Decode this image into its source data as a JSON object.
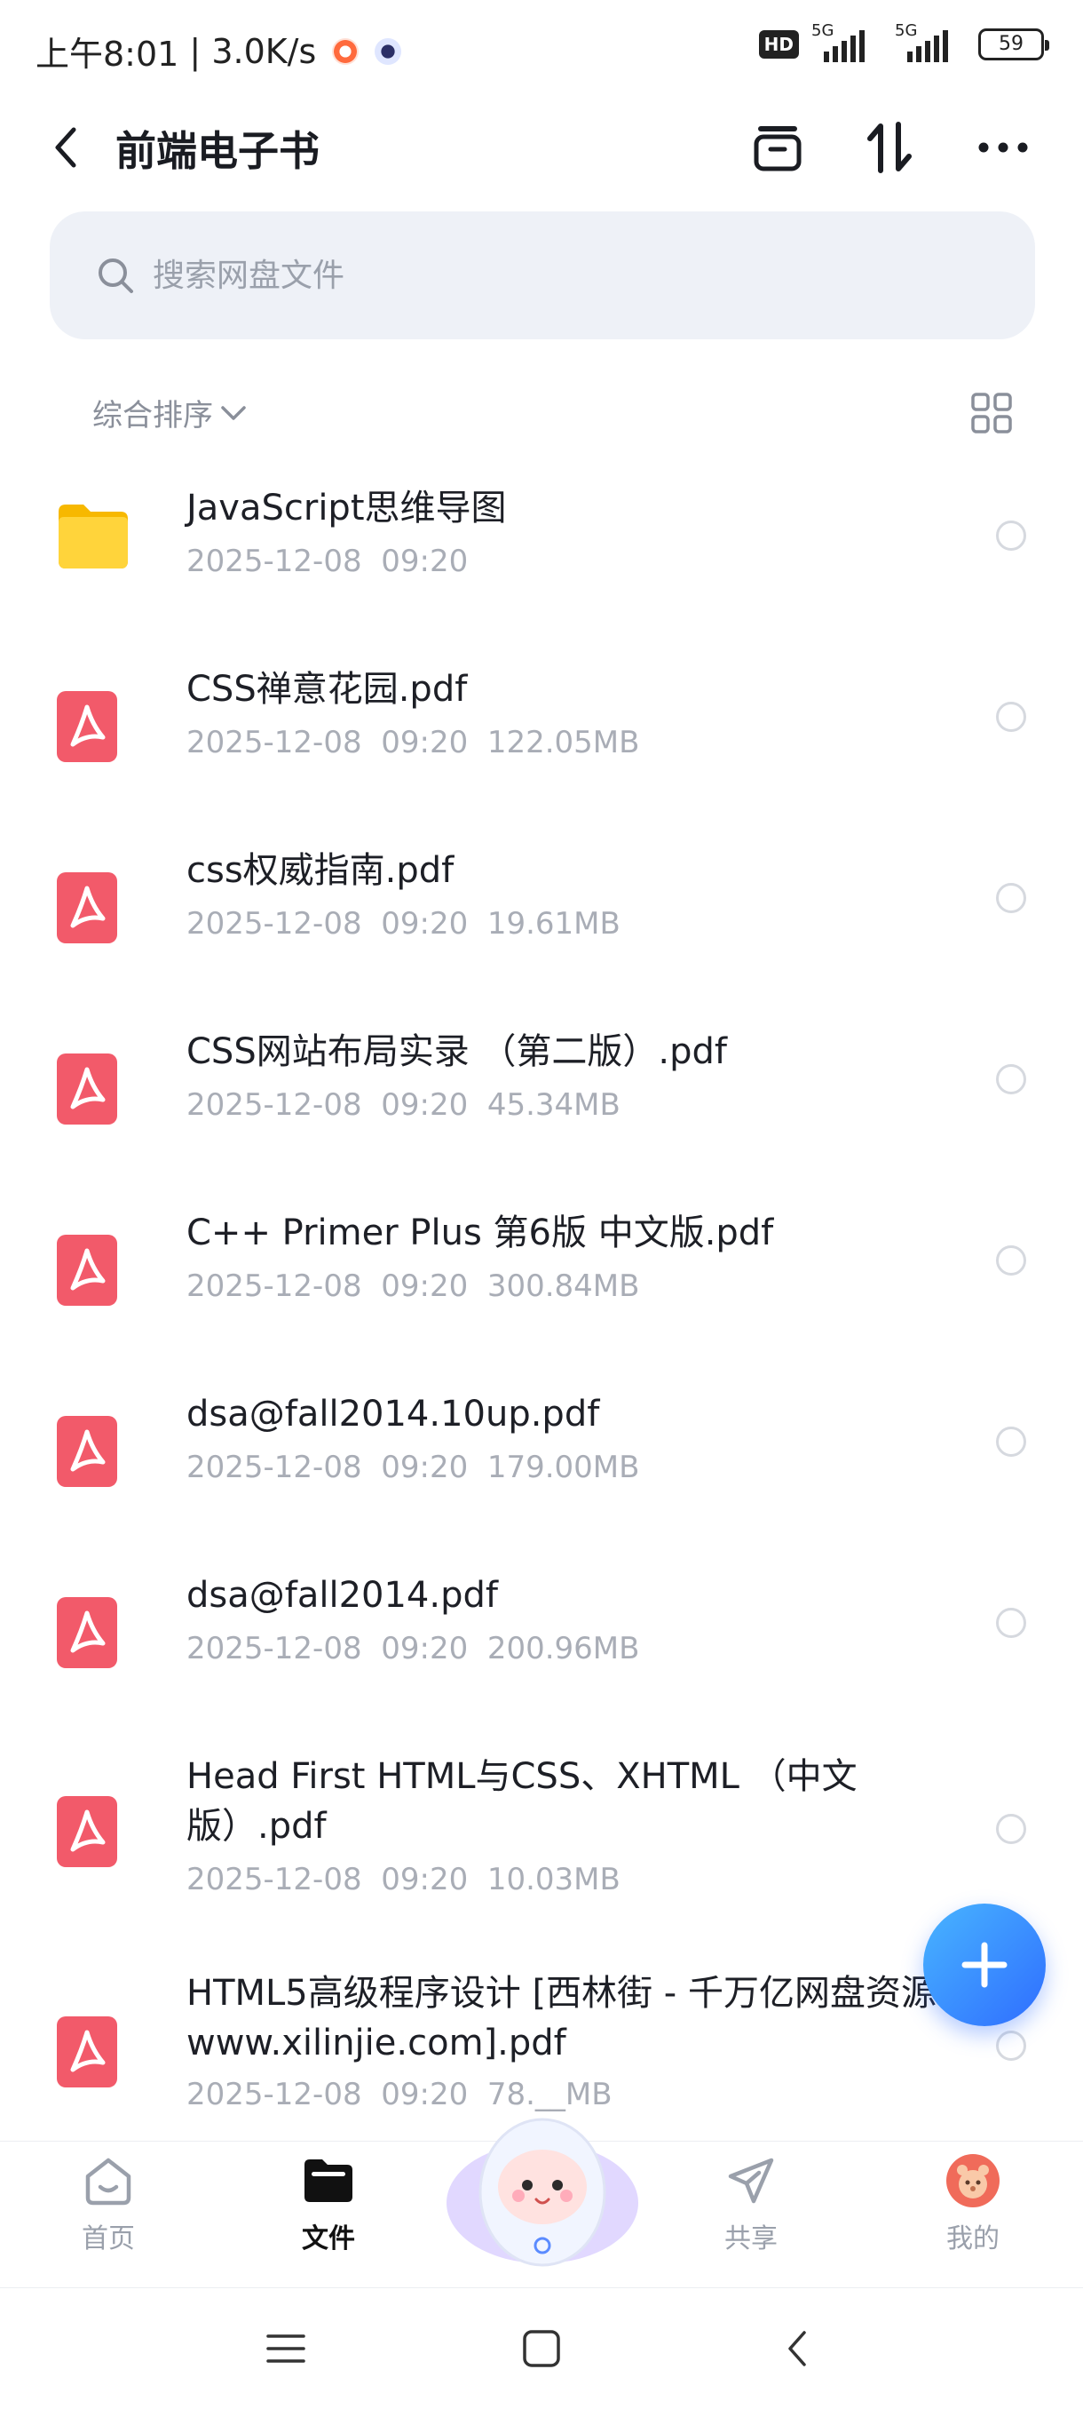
{
  "status_bar": {
    "time": "上午8:01",
    "speed": "3.0K/s",
    "hd_label": "HD",
    "network1": "5G",
    "network2": "5G",
    "battery": "59"
  },
  "header": {
    "title": "前端电子书"
  },
  "search": {
    "placeholder": "搜索网盘文件"
  },
  "sort": {
    "label": "综合排序"
  },
  "files": [
    {
      "name": "JavaScript思维导图",
      "date": "2025-12-08",
      "time": "09:20",
      "size": "",
      "type": "folder"
    },
    {
      "name": "CSS禅意花园.pdf",
      "date": "2025-12-08",
      "time": "09:20",
      "size": "122.05MB",
      "type": "pdf"
    },
    {
      "name": "css权威指南.pdf",
      "date": "2025-12-08",
      "time": "09:20",
      "size": "19.61MB",
      "type": "pdf"
    },
    {
      "name": "CSS网站布局实录 （第二版）.pdf",
      "date": "2025-12-08",
      "time": "09:20",
      "size": "45.34MB",
      "type": "pdf"
    },
    {
      "name": "C++ Primer Plus  第6版  中文版.pdf",
      "date": "2025-12-08",
      "time": "09:20",
      "size": "300.84MB",
      "type": "pdf"
    },
    {
      "name": "dsa@fall2014.10up.pdf",
      "date": "2025-12-08",
      "time": "09:20",
      "size": "179.00MB",
      "type": "pdf"
    },
    {
      "name": "dsa@fall2014.pdf",
      "date": "2025-12-08",
      "time": "09:20",
      "size": "200.96MB",
      "type": "pdf"
    },
    {
      "name": "Head First HTML与CSS、XHTML （中文版）.pdf",
      "date": "2025-12-08",
      "time": "09:20",
      "size": "10.03MB",
      "type": "pdf"
    },
    {
      "name": "HTML5高级程序设计 [西林街 - 千万亿网盘资源 www.xilinjie.com].pdf",
      "date": "2025-12-08",
      "time": "09:20",
      "size": "78.__MB",
      "type": "pdf"
    }
  ],
  "nav": {
    "home": "首页",
    "files": "文件",
    "share": "共享",
    "mine": "我的"
  },
  "colors": {
    "accent": "#2f6dff",
    "pdf": "#f25a6a",
    "folder": "#ffcf33"
  }
}
